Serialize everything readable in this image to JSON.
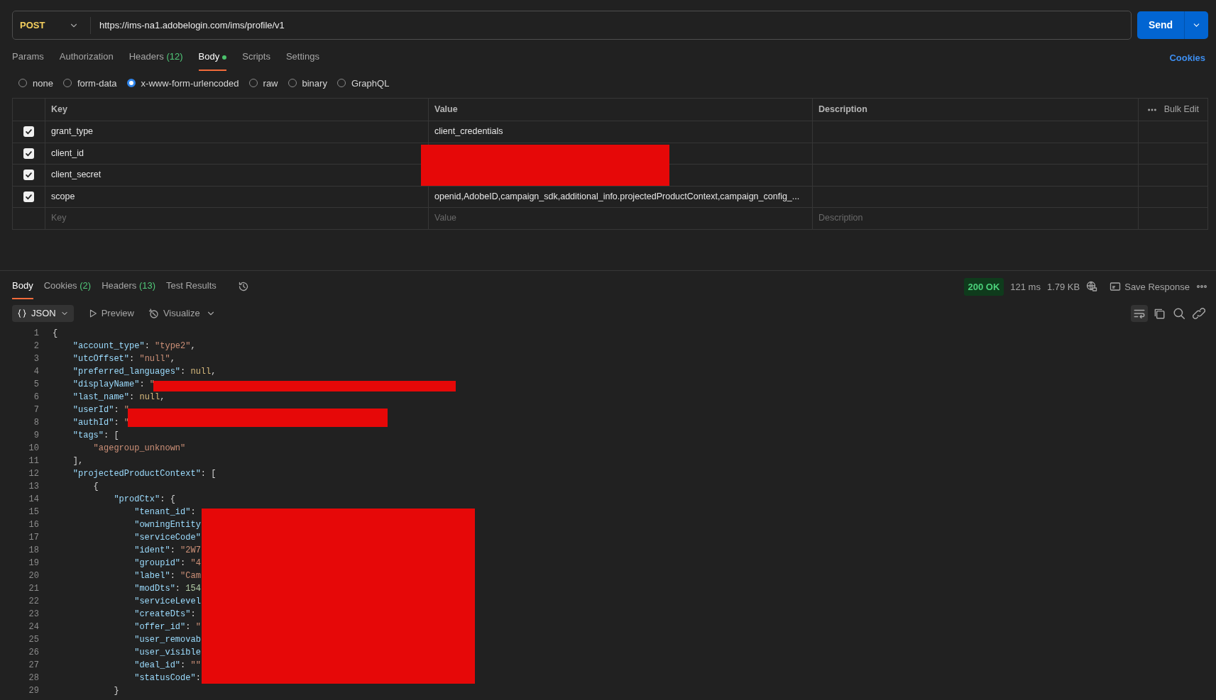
{
  "request": {
    "method": "POST",
    "url": "https://ims-na1.adobelogin.com/ims/profile/v1",
    "send_label": "Send"
  },
  "request_tabs": [
    {
      "label": "Params",
      "selected": false
    },
    {
      "label": "Authorization",
      "selected": false
    },
    {
      "label": "Headers",
      "count": "(12)",
      "selected": false
    },
    {
      "label": "Body",
      "selected": true,
      "dot": true
    },
    {
      "label": "Scripts",
      "selected": false
    },
    {
      "label": "Settings",
      "selected": false
    }
  ],
  "cookies_link": "Cookies",
  "body_types": [
    {
      "label": "none",
      "selected": false
    },
    {
      "label": "form-data",
      "selected": false
    },
    {
      "label": "x-www-form-urlencoded",
      "selected": true
    },
    {
      "label": "raw",
      "selected": false
    },
    {
      "label": "binary",
      "selected": false
    },
    {
      "label": "GraphQL",
      "selected": false
    }
  ],
  "params_table": {
    "columns": [
      "Key",
      "Value",
      "Description"
    ],
    "bulk_edit": "Bulk Edit",
    "rows": [
      {
        "key": "grant_type",
        "value": "client_credentials",
        "checked": true
      },
      {
        "key": "client_id",
        "checked": true,
        "redacted": true
      },
      {
        "key": "client_secret",
        "checked": true,
        "redacted": true
      },
      {
        "key": "scope",
        "value": "openid,AdobeID,campaign_sdk,additional_info.projectedProductContext,campaign_config_...",
        "checked": true
      }
    ],
    "placeholders": {
      "key": "Key",
      "value": "Value",
      "description": "Description"
    }
  },
  "response_tabs": [
    {
      "label": "Body",
      "selected": true
    },
    {
      "label": "Cookies",
      "count": "(2)",
      "selected": false
    },
    {
      "label": "Headers",
      "count": "(13)",
      "selected": false
    },
    {
      "label": "Test Results",
      "selected": false
    }
  ],
  "response_meta": {
    "status": "200 OK",
    "time": "121 ms",
    "size": "1.79 KB",
    "save": "Save Response"
  },
  "format": {
    "label": "JSON",
    "preview": "Preview",
    "visualize": "Visualize"
  },
  "code_lines": [
    {
      "n": "1",
      "tokens": [
        {
          "kind": "punct",
          "text": "{"
        }
      ]
    },
    {
      "n": "2",
      "tokens": [
        {
          "kind": "key",
          "text": "    \"account_type\""
        },
        {
          "kind": "punct",
          "text": ": "
        },
        {
          "kind": "str",
          "text": "\"type2\""
        },
        {
          "kind": "punct",
          "text": ","
        }
      ]
    },
    {
      "n": "3",
      "tokens": [
        {
          "kind": "key",
          "text": "    \"utcOffset\""
        },
        {
          "kind": "punct",
          "text": ": "
        },
        {
          "kind": "str",
          "text": "\"null\""
        },
        {
          "kind": "punct",
          "text": ","
        }
      ]
    },
    {
      "n": "4",
      "tokens": [
        {
          "kind": "key",
          "text": "    \"preferred_languages\""
        },
        {
          "kind": "punct",
          "text": ": "
        },
        {
          "kind": "lit",
          "text": "null"
        },
        {
          "kind": "punct",
          "text": ","
        }
      ]
    },
    {
      "n": "5",
      "tokens": [
        {
          "kind": "key",
          "text": "    \"displayName\""
        },
        {
          "kind": "punct",
          "text": ": "
        },
        {
          "kind": "str",
          "text": "\""
        }
      ]
    },
    {
      "n": "6",
      "tokens": [
        {
          "kind": "key",
          "text": "    \"last_name\""
        },
        {
          "kind": "punct",
          "text": ": "
        },
        {
          "kind": "lit",
          "text": "null"
        },
        {
          "kind": "punct",
          "text": ","
        }
      ]
    },
    {
      "n": "7",
      "tokens": [
        {
          "kind": "key",
          "text": "    \"userId\""
        },
        {
          "kind": "punct",
          "text": ": "
        },
        {
          "kind": "str",
          "text": "\""
        }
      ]
    },
    {
      "n": "8",
      "tokens": [
        {
          "kind": "key",
          "text": "    \"authId\""
        },
        {
          "kind": "punct",
          "text": ": "
        },
        {
          "kind": "str",
          "text": "\""
        }
      ]
    },
    {
      "n": "9",
      "tokens": [
        {
          "kind": "key",
          "text": "    \"tags\""
        },
        {
          "kind": "punct",
          "text": ": ["
        }
      ]
    },
    {
      "n": "10",
      "tokens": [
        {
          "kind": "str",
          "text": "        \"agegroup_unknown\""
        }
      ]
    },
    {
      "n": "11",
      "tokens": [
        {
          "kind": "punct",
          "text": "    ],"
        }
      ]
    },
    {
      "n": "12",
      "tokens": [
        {
          "kind": "key",
          "text": "    \"projectedProductContext\""
        },
        {
          "kind": "punct",
          "text": ": ["
        }
      ]
    },
    {
      "n": "13",
      "tokens": [
        {
          "kind": "punct",
          "text": "        {"
        }
      ]
    },
    {
      "n": "14",
      "tokens": [
        {
          "kind": "key",
          "text": "            \"prodCtx\""
        },
        {
          "kind": "punct",
          "text": ": {"
        }
      ]
    },
    {
      "n": "15",
      "tokens": [
        {
          "kind": "key",
          "text": "                \"tenant_id\""
        },
        {
          "kind": "punct",
          "text": ":"
        }
      ]
    },
    {
      "n": "16",
      "tokens": [
        {
          "kind": "key",
          "text": "                \"owningEntity"
        }
      ]
    },
    {
      "n": "17",
      "tokens": [
        {
          "kind": "key",
          "text": "                \"serviceCode\""
        }
      ]
    },
    {
      "n": "18",
      "tokens": [
        {
          "kind": "key",
          "text": "                \"ident\""
        },
        {
          "kind": "punct",
          "text": ": "
        },
        {
          "kind": "str",
          "text": "\"2W7"
        }
      ]
    },
    {
      "n": "19",
      "tokens": [
        {
          "kind": "key",
          "text": "                \"groupid\""
        },
        {
          "kind": "punct",
          "text": ": "
        },
        {
          "kind": "str",
          "text": "\"4"
        }
      ]
    },
    {
      "n": "20",
      "tokens": [
        {
          "kind": "key",
          "text": "                \"label\""
        },
        {
          "kind": "punct",
          "text": ": "
        },
        {
          "kind": "str",
          "text": "\"Cam"
        }
      ]
    },
    {
      "n": "21",
      "tokens": [
        {
          "kind": "key",
          "text": "                \"modDts\""
        },
        {
          "kind": "punct",
          "text": ": "
        },
        {
          "kind": "num",
          "text": "154"
        }
      ]
    },
    {
      "n": "22",
      "tokens": [
        {
          "kind": "key",
          "text": "                \"serviceLevel"
        }
      ]
    },
    {
      "n": "23",
      "tokens": [
        {
          "kind": "key",
          "text": "                \"createDts\""
        },
        {
          "kind": "punct",
          "text": ":"
        }
      ]
    },
    {
      "n": "24",
      "tokens": [
        {
          "kind": "key",
          "text": "                \"offer_id\""
        },
        {
          "kind": "punct",
          "text": ": "
        },
        {
          "kind": "str",
          "text": "\""
        }
      ]
    },
    {
      "n": "25",
      "tokens": [
        {
          "kind": "key",
          "text": "                \"user_removab"
        }
      ]
    },
    {
      "n": "26",
      "tokens": [
        {
          "kind": "key",
          "text": "                \"user_visible"
        }
      ]
    },
    {
      "n": "27",
      "tokens": [
        {
          "kind": "key",
          "text": "                \"deal_id\""
        },
        {
          "kind": "punct",
          "text": ": "
        },
        {
          "kind": "str",
          "text": "\"\""
        }
      ]
    },
    {
      "n": "28",
      "tokens": [
        {
          "kind": "key",
          "text": "                \"statusCode\""
        },
        {
          "kind": "punct",
          "text": ":"
        }
      ]
    },
    {
      "n": "29",
      "tokens": [
        {
          "kind": "punct",
          "text": "            }"
        }
      ]
    }
  ]
}
